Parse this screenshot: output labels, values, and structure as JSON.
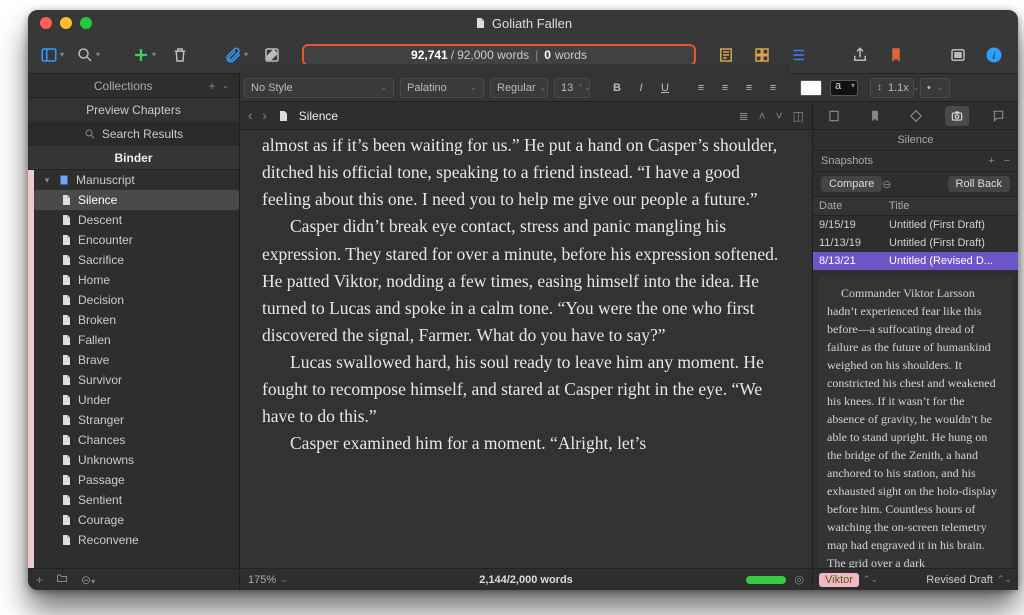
{
  "window_title": "Goliath Fallen",
  "wordcount": {
    "current": "92,741",
    "target": "92,000 words",
    "session": "0",
    "session_label": "words"
  },
  "format": {
    "style": "No Style",
    "font": "Palatino",
    "weight": "Regular",
    "size": "13",
    "line": "1.1x",
    "list": "•"
  },
  "collections_header": "Collections",
  "left_tabs": {
    "preview": "Preview Chapters",
    "search": "Search Results",
    "binder": "Binder"
  },
  "manuscript_label": "Manuscript",
  "chapters": [
    "Silence",
    "Descent",
    "Encounter",
    "Sacrifice",
    "Home",
    "Decision",
    "Broken",
    "Fallen",
    "Brave",
    "Survivor",
    "Under",
    "Stranger",
    "Chances",
    "Unknowns",
    "Passage",
    "Sentient",
    "Courage",
    "Reconvene"
  ],
  "selected_chapter": 0,
  "editor": {
    "title": "Silence",
    "zoom": "175%",
    "footer_count": "2,144/2,000 words",
    "p1": "almost as if it’s been waiting for us.” He put a hand on Casper’s shoulder, ditched his official tone, speaking to a friend instead. “I have a good feeling about this one. I need you to help me give our people a future.”",
    "p2": "Casper didn’t break eye contact, stress and panic mangling his expression. They stared for over a minute, before his expression softened. He patted Viktor, nodding a few times, easing himself into the idea. He turned to Lucas and spoke in a calm tone. “You were the one who first discovered the signal, Farmer. What do you have to say?”",
    "p3": "Lucas swallowed hard, his soul ready to leave him any moment. He fought to recompose himself, and stared at Casper right in the eye. “We have to do this.”",
    "p4": "Casper examined him for a moment. “Alright, let’s"
  },
  "inspector": {
    "title": "Silence",
    "snapshots_label": "Snapshots",
    "compare": "Compare",
    "rollback": "Roll Back",
    "col_date": "Date",
    "col_title": "Title",
    "rows": [
      {
        "date": "9/15/19",
        "title": "Untitled (First Draft)"
      },
      {
        "date": "11/13/19",
        "title": "Untitled (First Draft)"
      },
      {
        "date": "8/13/21",
        "title": "Untitled (Revised D..."
      }
    ],
    "selected_row": 2,
    "preview": "Commander Viktor Larsson hadn’t experienced fear like this before—a suffocating dread of failure as the future of humankind weighed on his shoulders. It constricted his chest and weakened his knees. If it wasn’t for the absence of gravity, he wouldn’t be able to stand upright. He hung on the bridge of the Zenith, a hand anchored to his station, and his exhausted sight on the holo-display before him. Countless hours of watching the on-screen telemetry map had engraved it in his brain. The grid over a dark",
    "tag": "Viktor",
    "revision": "Revised Draft"
  }
}
